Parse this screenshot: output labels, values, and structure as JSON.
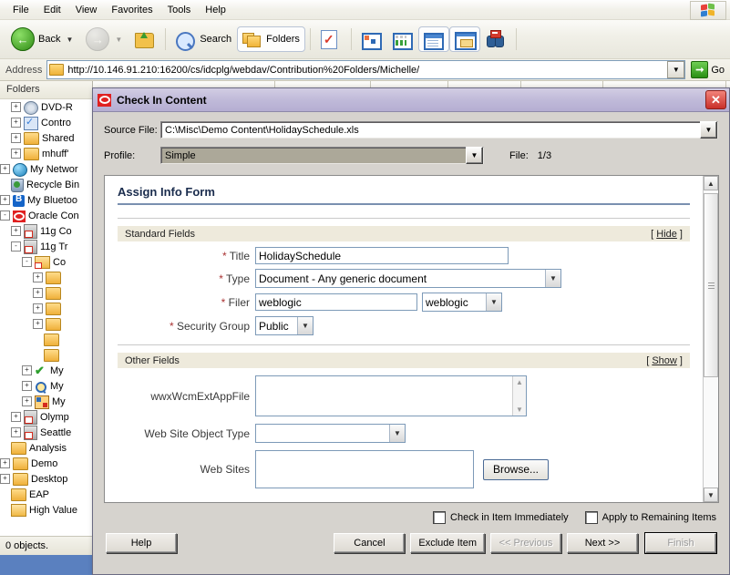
{
  "explorer": {
    "menu": [
      "File",
      "Edit",
      "View",
      "Favorites",
      "Tools",
      "Help"
    ],
    "toolbar": {
      "back_label": "Back",
      "search_label": "Search",
      "folders_label": "Folders"
    },
    "address": {
      "label": "Address",
      "url": "http://10.146.91.210:16200/cs/idcplg/webdav/Contribution%20Folders/Michelle/",
      "go_label": "Go"
    },
    "tree_header": "Folders",
    "tree": [
      {
        "indent": 2,
        "exp": "+",
        "icon": "dvd-icon",
        "label": "DVD-R"
      },
      {
        "indent": 2,
        "exp": "+",
        "icon": "control-panel-icon",
        "label": "Contro"
      },
      {
        "indent": 2,
        "exp": "+",
        "icon": "folder-icon",
        "label": "Shared"
      },
      {
        "indent": 2,
        "exp": "+",
        "icon": "folder-icon",
        "label": "mhuff'"
      },
      {
        "indent": 1,
        "exp": "+",
        "icon": "network-icon",
        "label": "My Networ"
      },
      {
        "indent": 1,
        "exp": "",
        "icon": "recycle-bin-icon",
        "label": "Recycle Bin"
      },
      {
        "indent": 1,
        "exp": "+",
        "icon": "bluetooth-icon",
        "label": "My Bluetoo"
      },
      {
        "indent": 1,
        "exp": "-",
        "icon": "oracle-icon",
        "label": "Oracle Con"
      },
      {
        "indent": 2,
        "exp": "+",
        "icon": "server-icon",
        "label": "11g Co"
      },
      {
        "indent": 2,
        "exp": "-",
        "icon": "server-icon",
        "label": "11g Tr"
      },
      {
        "indent": 3,
        "exp": "-",
        "icon": "folder-server-icon",
        "label": "Co"
      },
      {
        "indent": 4,
        "exp": "+",
        "icon": "folder-icon",
        "label": ""
      },
      {
        "indent": 4,
        "exp": "+",
        "icon": "folder-icon",
        "label": ""
      },
      {
        "indent": 4,
        "exp": "+",
        "icon": "folder-icon",
        "label": ""
      },
      {
        "indent": 4,
        "exp": "+",
        "icon": "folder-icon",
        "label": ""
      },
      {
        "indent": 4,
        "exp": "",
        "icon": "folder-icon",
        "label": ""
      },
      {
        "indent": 4,
        "exp": "",
        "icon": "folder-icon",
        "label": ""
      },
      {
        "indent": 3,
        "exp": "+",
        "icon": "check-icon",
        "label": "My"
      },
      {
        "indent": 3,
        "exp": "+",
        "icon": "saved-search-icon",
        "label": "My"
      },
      {
        "indent": 3,
        "exp": "+",
        "icon": "image-icon",
        "label": "My"
      },
      {
        "indent": 2,
        "exp": "+",
        "icon": "server-icon",
        "label": "Olymp"
      },
      {
        "indent": 2,
        "exp": "+",
        "icon": "server-icon",
        "label": "Seattle"
      },
      {
        "indent": 1,
        "exp": "",
        "icon": "folder-icon",
        "label": "Analysis"
      },
      {
        "indent": 1,
        "exp": "+",
        "icon": "folder-icon",
        "label": "Demo"
      },
      {
        "indent": 1,
        "exp": "+",
        "icon": "folder-icon",
        "label": "Desktop"
      },
      {
        "indent": 1,
        "exp": "",
        "icon": "folder-icon",
        "label": "EAP"
      },
      {
        "indent": 1,
        "exp": "",
        "icon": "folder-open-icon",
        "label": "High Value"
      }
    ],
    "columns": [
      "",
      "",
      "",
      "",
      "",
      ""
    ],
    "status": "0 objects."
  },
  "dialog": {
    "title": "Check In Content",
    "close_label": "✕",
    "source_file_label": "Source File:",
    "source_file_value": "C:\\Misc\\Demo Content\\HolidaySchedule.xls",
    "profile_label": "Profile:",
    "profile_value": "Simple",
    "file_label": "File:",
    "file_count": "1/3",
    "form": {
      "title": "Assign Info Form",
      "standard_section": {
        "name": "Standard Fields",
        "toggle": "Hide"
      },
      "other_section": {
        "name": "Other Fields",
        "toggle": "Show"
      },
      "fields": {
        "title_label": "Title",
        "title_value": "HolidaySchedule",
        "type_label": "Type",
        "type_value": "Document - Any generic document",
        "filer_label": "Filer",
        "filer_value": "weblogic",
        "filer_select_value": "weblogic",
        "security_group_label": "Security Group",
        "security_group_value": "Public",
        "required_marker": "*",
        "wwx_label": "wwxWcmExtAppFile",
        "wwx_value": "",
        "web_site_object_type_label": "Web Site Object Type",
        "web_site_object_type_value": "",
        "web_sites_label": "Web Sites",
        "web_sites_value": "",
        "browse_label": "Browse..."
      }
    },
    "checkboxes": [
      {
        "label": "Check in Item Immediately",
        "checked": false
      },
      {
        "label": "Apply to Remaining Items",
        "checked": false
      }
    ],
    "buttons": {
      "help": "Help",
      "cancel": "Cancel",
      "exclude": "Exclude Item",
      "previous": "<< Previous",
      "next": "Next >>",
      "finish": "Finish"
    }
  }
}
